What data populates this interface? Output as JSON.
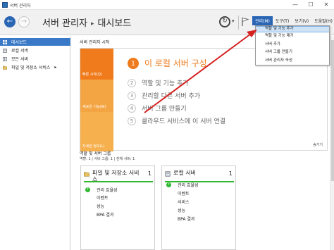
{
  "window": {
    "title": "서버 관리자",
    "controls": [
      "—",
      "☐",
      "✕"
    ]
  },
  "header": {
    "breadcrumb_root": "서버 관리자",
    "breadcrumb_sep": "▸",
    "breadcrumb_current": "대시보드",
    "menus": [
      "관리(M)",
      "도구(T)",
      "보기(V)",
      "도움말(H)"
    ],
    "active_menu": "관리(M)"
  },
  "sidebar": {
    "items": [
      {
        "label": "대시보드",
        "icon": "dashboard-grid-icon",
        "active": true
      },
      {
        "label": "로컬 서버",
        "icon": "server-icon",
        "active": false
      },
      {
        "label": "모든 서버",
        "icon": "servers-icon",
        "active": false
      },
      {
        "label": "파일 및 저장소 서비스",
        "icon": "folder-icon",
        "active": false,
        "chevron": "▸"
      }
    ]
  },
  "welcome": {
    "title": "서버 관리자 시작",
    "tiles": [
      "빠른 시작(Q)",
      "새로운 기능(W)",
      "자세한 정보(L)"
    ],
    "steps": [
      {
        "num": "1",
        "text": "이 로컬 서버 구성"
      },
      {
        "num": "2",
        "text": "역할 및 기능 추가"
      },
      {
        "num": "3",
        "text": "관리할 다른 서버 추가"
      },
      {
        "num": "4",
        "text": "서버 그룹 만들기"
      },
      {
        "num": "5",
        "text": "클라우드 서비스에 이 서버 연결"
      }
    ],
    "hide_link": "숨기기"
  },
  "roles": {
    "title": "역할 및 서버 그룹",
    "counts": "역할: 1 | 서버 그룹: 1 | 전체 서버: 1",
    "cards": [
      {
        "title": "파일 및 저장소 서비스",
        "count": "1",
        "icon": "folder-icon",
        "status": "관리 효율성",
        "rows": [
          "이벤트",
          "성능",
          "BPA 결과"
        ]
      },
      {
        "title": "로컬 서버",
        "count": "1",
        "icon": "server-icon",
        "status": "관리 효율성",
        "rows": [
          "이벤트",
          "서비스",
          "성능",
          "BPA 결과"
        ]
      }
    ]
  },
  "dropdown": {
    "items": [
      "역할 및 기능 추가",
      "역할 및 기능 제거",
      "서버 추가",
      "서버 그룹 만들기",
      "서버 관리자 속성"
    ],
    "highlighted": "역할 및 기능 추가"
  },
  "colors": {
    "accent_blue": "#2b66b5",
    "orange": "#ef7b1c",
    "status_green": "#2eb82e",
    "annotation_arrow": "#d62020"
  }
}
